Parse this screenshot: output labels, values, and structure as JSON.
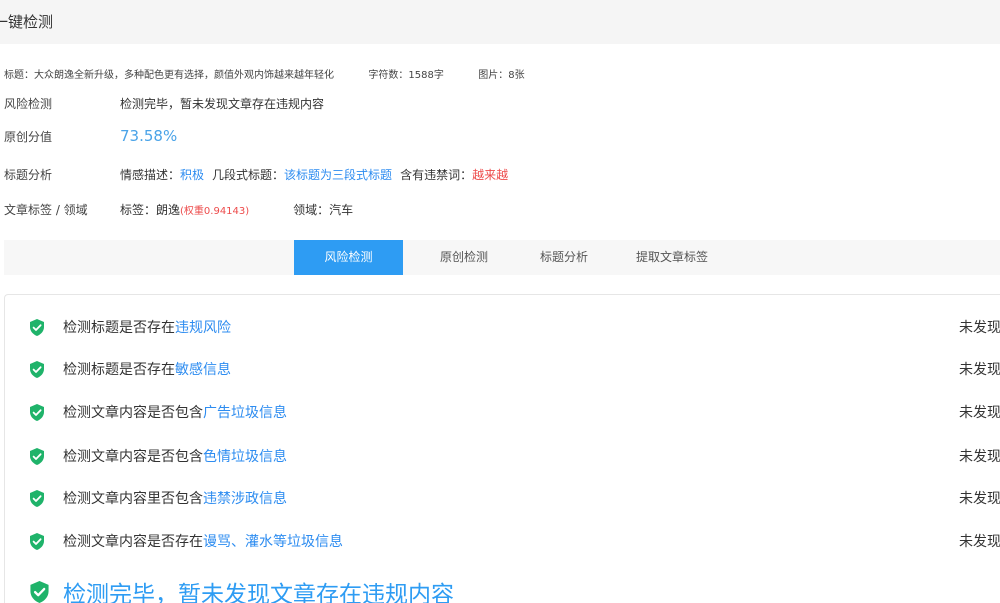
{
  "header": {
    "title": "一键检测"
  },
  "meta": {
    "title_label": "标题：大众朗逸全新升级，多种配色更有选择，颜值外观内饰越来越年轻化",
    "char_count": "字符数：1588字",
    "images": "图片：8张"
  },
  "risk": {
    "label": "风险检测",
    "value": "检测完毕，暂未发现文章存在违规内容"
  },
  "originality": {
    "label": "原创分值",
    "value": "73.58%"
  },
  "title_analysis": {
    "label": "标题分析",
    "emotion_label": "情感描述：",
    "emotion_value": "积极",
    "segment_label": "几段式标题：",
    "segment_value": "该标题为三段式标题",
    "banned_label": "含有违禁词：",
    "banned_value": "越来越"
  },
  "tags": {
    "label": "文章标签 / 领域",
    "tag_label": "标签：朗逸",
    "tag_weight": "(权重0.94143)",
    "field": "领域：汽车"
  },
  "tabs": [
    {
      "label": "风险检测",
      "active": true
    },
    {
      "label": "原创检测",
      "active": false
    },
    {
      "label": "标题分析",
      "active": false
    },
    {
      "label": "提取文章标签",
      "active": false
    }
  ],
  "checks": [
    {
      "text": "检测标题是否存在",
      "link": "违规风险",
      "status": "未发现"
    },
    {
      "text": "检测标题是否存在",
      "link": "敏感信息",
      "status": "未发现"
    },
    {
      "text": "检测文章内容是否包含",
      "link": "广告垃圾信息",
      "status": "未发现"
    },
    {
      "text": "检测文章内容是否包含",
      "link": "色情垃圾信息",
      "status": "未发现"
    },
    {
      "text": "检测文章内容里否包含",
      "link": "违禁涉政信息",
      "status": "未发现"
    },
    {
      "text": "检测文章内容是否存在",
      "link": "谩骂、灌水等垃圾信息",
      "status": "未发现"
    }
  ],
  "final": {
    "text": "检测完毕，暂未发现文章存在违规内容"
  },
  "colors": {
    "accent": "#2e9cf3",
    "link": "#2d8cf0",
    "danger": "#ed4b4b",
    "shield": "#1fb36a"
  },
  "icons": {
    "check": "shield-check-icon"
  }
}
